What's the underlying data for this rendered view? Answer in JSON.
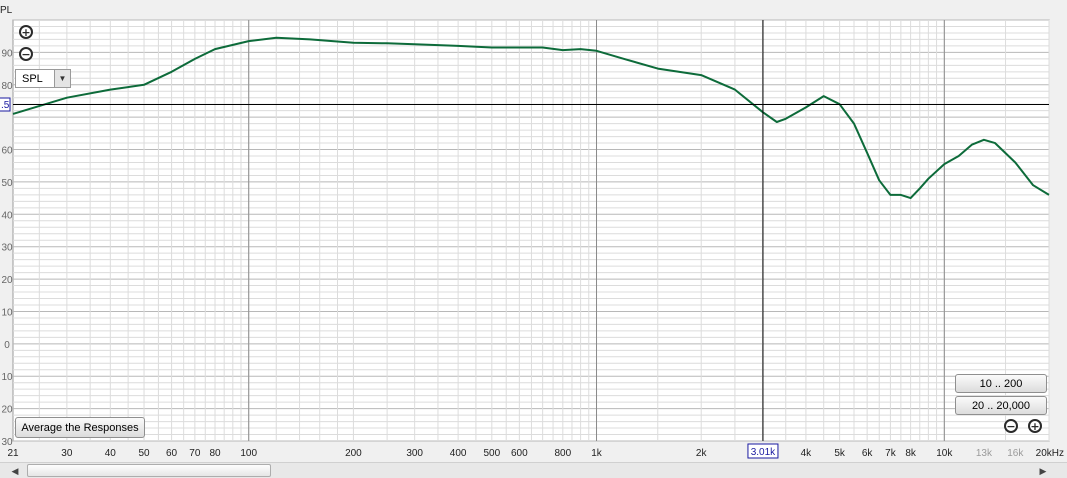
{
  "chart_data": {
    "type": "line",
    "xscale": "log",
    "xlim": [
      21,
      20000
    ],
    "ylim": [
      -30,
      100
    ],
    "yunit_label": "PL",
    "cursor": {
      "x": 3010,
      "y_label": ".5"
    },
    "x_ticks": [
      {
        "v": 21,
        "label": "21"
      },
      {
        "v": 30,
        "label": "30"
      },
      {
        "v": 40,
        "label": "40"
      },
      {
        "v": 50,
        "label": "50"
      },
      {
        "v": 60,
        "label": "60"
      },
      {
        "v": 70,
        "label": "70"
      },
      {
        "v": 80,
        "label": "80"
      },
      {
        "v": 100,
        "label": "100"
      },
      {
        "v": 200,
        "label": "200"
      },
      {
        "v": 300,
        "label": "300"
      },
      {
        "v": 400,
        "label": "400"
      },
      {
        "v": 500,
        "label": "500"
      },
      {
        "v": 600,
        "label": "600"
      },
      {
        "v": 800,
        "label": "800"
      },
      {
        "v": 1000,
        "label": "1k"
      },
      {
        "v": 2000,
        "label": "2k"
      },
      {
        "v": 4000,
        "label": "4k"
      },
      {
        "v": 5000,
        "label": "5k"
      },
      {
        "v": 6000,
        "label": "6k"
      },
      {
        "v": 7000,
        "label": "7k"
      },
      {
        "v": 8000,
        "label": "8k"
      },
      {
        "v": 10000,
        "label": "10k"
      },
      {
        "v": 13000,
        "label": "13k",
        "faded": true
      },
      {
        "v": 16000,
        "label": "16k",
        "faded": true
      },
      {
        "v": 20000,
        "label": "20kHz"
      }
    ],
    "y_ticks": [
      {
        "v": 90,
        "label": "90"
      },
      {
        "v": 80,
        "label": "80"
      },
      {
        "v": 60,
        "label": "60"
      },
      {
        "v": 50,
        "label": "50"
      },
      {
        "v": 40,
        "label": "40"
      },
      {
        "v": 30,
        "label": "30"
      },
      {
        "v": 20,
        "label": "20"
      },
      {
        "v": 10,
        "label": "10"
      },
      {
        "v": 0,
        "label": "0"
      },
      {
        "v": -10,
        "label": "10"
      },
      {
        "v": -20,
        "label": "20"
      },
      {
        "v": -30,
        "label": "30"
      }
    ],
    "series": [
      {
        "color": "#0d6b3a",
        "x": [
          21,
          30,
          40,
          50,
          60,
          70,
          80,
          100,
          120,
          150,
          200,
          250,
          300,
          400,
          500,
          600,
          700,
          800,
          900,
          1000,
          1200,
          1500,
          2000,
          2500,
          3010,
          3300,
          3500,
          4000,
          4500,
          5000,
          5500,
          6000,
          6500,
          7000,
          7500,
          8000,
          8500,
          9000,
          10000,
          11000,
          12000,
          13000,
          14000,
          16000,
          18000,
          20000
        ],
        "y": [
          71,
          76,
          78.5,
          80,
          84,
          88,
          91,
          93.5,
          94.5,
          94,
          93,
          92.8,
          92.5,
          92,
          91.5,
          91.5,
          91.5,
          90.7,
          91,
          90.5,
          88,
          85,
          83,
          78.5,
          71.5,
          68.5,
          69.5,
          73,
          76.5,
          74,
          68,
          59,
          50.5,
          46,
          46,
          45,
          48,
          51,
          55.5,
          58,
          61.5,
          63,
          62,
          56,
          49,
          46
        ]
      }
    ]
  },
  "controls": {
    "zoom_in_icon": "plus-circle-icon",
    "zoom_out_icon": "minus-circle-icon",
    "zoom_in_symbol": "+",
    "zoom_out_symbol": "−",
    "y_select_value": "SPL",
    "y_select_arrow": "▼",
    "average_button": "Average the Responses",
    "range_button_1": "10 .. 200",
    "range_button_2": "20 .. 20,000",
    "cursor_x_label": "3.01k",
    "scroll_left": "◀",
    "scroll_right": "▶"
  },
  "colors": {
    "background": "#ffffff",
    "grid_major": "#b8b8b8",
    "grid_minor": "#dcdcdc",
    "trace": "#0d6b3a",
    "cursor": "#000000",
    "cursor_label": "#1a1aa0"
  }
}
